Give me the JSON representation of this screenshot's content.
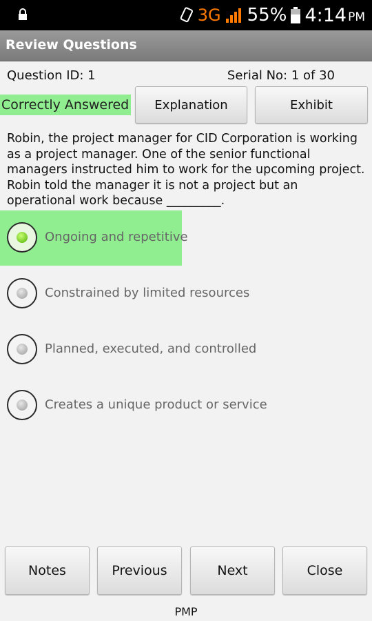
{
  "status_bar": {
    "network": "3G",
    "battery_percent": "55%",
    "time": "4:14",
    "ampm": "PM",
    "icons": [
      "lock-icon",
      "phone-rotate-icon",
      "signal-icon",
      "battery-icon"
    ]
  },
  "header": {
    "title": "Review Questions"
  },
  "question_info": {
    "id_label": "Question ID: 1",
    "serial_label": "Serial No: 1 of 30"
  },
  "result": {
    "status": "Correctly Answered",
    "color": "#90ee90"
  },
  "actions": {
    "explanation": "Explanation",
    "exhibit": "Exhibit"
  },
  "question": {
    "text": "Robin, the project manager for CID Corporation is working as a project manager. One of the senior functional managers instructed him to work for the upcoming project. Robin told the manager it is not a project but an operational work because _________."
  },
  "options": [
    {
      "label": "Ongoing and repetitive",
      "selected": true
    },
    {
      "label": "Constrained by limited resources",
      "selected": false
    },
    {
      "label": "Planned, executed, and controlled",
      "selected": false
    },
    {
      "label": "Creates a unique product or service",
      "selected": false
    }
  ],
  "nav": {
    "notes": "Notes",
    "previous": "Previous",
    "next": "Next",
    "close": "Close"
  },
  "footer": {
    "label": "PMP"
  }
}
